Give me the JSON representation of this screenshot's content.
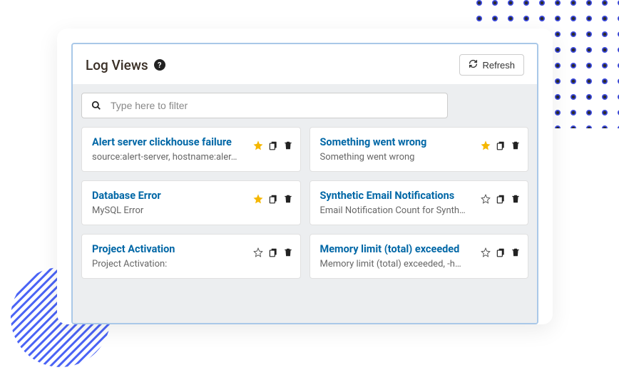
{
  "header": {
    "title": "Log Views",
    "refresh_label": "Refresh"
  },
  "filter": {
    "placeholder": "Type here to filter"
  },
  "views": [
    {
      "title": "Alert server clickhouse failure",
      "subtitle": "source:alert-server, hostname:aler…",
      "starred": true
    },
    {
      "title": "Something went wrong",
      "subtitle": "Something went wrong",
      "starred": true
    },
    {
      "title": "Database Error",
      "subtitle": "MySQL Error",
      "starred": true
    },
    {
      "title": "Synthetic Email Notifications",
      "subtitle": "Email Notification Count for Synth…",
      "starred": false
    },
    {
      "title": "Project Activation",
      "subtitle": "Project Activation:",
      "starred": false
    },
    {
      "title": "Memory limit (total) exceeded",
      "subtitle": "Memory limit (total) exceeded, -ho…",
      "starred": false
    }
  ]
}
